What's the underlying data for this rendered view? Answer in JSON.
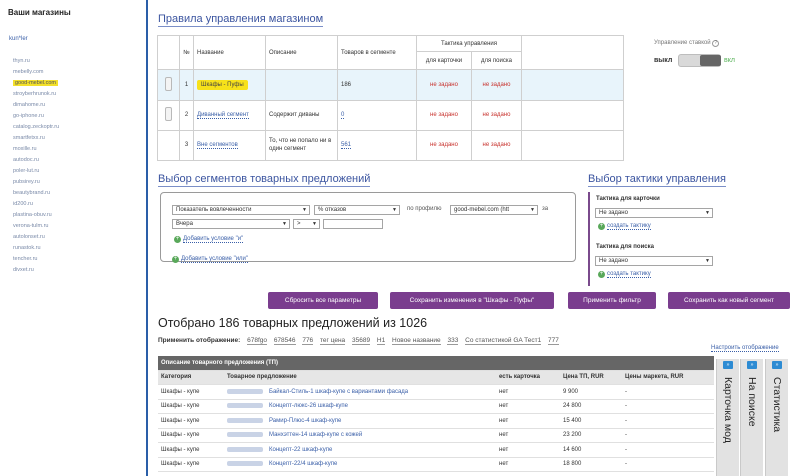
{
  "sidebar": {
    "title": "Ваши магазины",
    "user": "kun*ler",
    "shops": [
      "thyn.ru",
      "mebelly.com",
      "good-mebel.com",
      "stroyberhrunok.ru",
      "dimahome.ru",
      "go-iphone.ru",
      "catalog.zeckoptr.ru",
      "smartfetxx.ru",
      "moxille.ru",
      "autodoc.ru",
      "poler-lut.ru",
      "pubsirey.ru",
      "beautybrand.ru",
      "id200.ru",
      "plastina-obuv.ru",
      "verona-tulm.ru",
      "autolonset.ru",
      "runastok.ru",
      "tencher.ru",
      "divxet.ru"
    ],
    "active_shop": "good-mebel.com"
  },
  "rules": {
    "title": "Правила управления магазином",
    "headers": {
      "num": "№",
      "name": "Название",
      "desc": "Описание",
      "goods": "Товаров в сегменте",
      "tactic": "Тактика управления",
      "card": "для карточки",
      "search": "для поиска"
    },
    "rows": [
      {
        "num": "1",
        "name": "Шкафы - Пуфы",
        "desc": "",
        "count": "186",
        "card": "не задано",
        "search": "не задано"
      },
      {
        "num": "2",
        "name": "Диванный сегмент",
        "desc": "Содержит диваны",
        "count": "0",
        "card": "не задано",
        "search": "не задано"
      },
      {
        "num": "3",
        "name": "Вне сегментов",
        "desc": "То, что не попало ни в один сегмент",
        "count": "561",
        "card": "не задано",
        "search": "не задано"
      }
    ]
  },
  "bid_control": {
    "label": "Управление ставкой",
    "help": "?",
    "off": "выкл",
    "on": "вкл",
    "state": "off"
  },
  "segment_select": {
    "title": "Выбор сегментов товарных предложений",
    "metric": "Показатель вовлеченности",
    "measure": "% отказов",
    "by_profile": "по профилю",
    "profile": "good-mebel.com (htt",
    "for": "за",
    "period": "Вчера",
    "operator": ">",
    "value": "",
    "add_and": "Добавить условие \"и\"",
    "add_or": "Добавить условие \"или\""
  },
  "tactic_select": {
    "title": "Выбор тактики управления",
    "card_label": "Тактика для карточки",
    "card_value": "Не задано",
    "card_create": "создать тактику",
    "search_label": "Тактика для поиска",
    "search_value": "Не задано",
    "search_create": "создать тактику"
  },
  "buttons": {
    "reset": "Сбросить все параметры",
    "save_changes": "Сохранить изменения в \"Шкафы - Пуфы\"",
    "apply_filter": "Применить фильтр",
    "save_new": "Сохранить как новый сегмент"
  },
  "results": {
    "found_text": "Отобрано 186 товарных предложений из 1026",
    "apply_label": "Применить отображение:",
    "display_chips": [
      "678fgo",
      "678546",
      "776",
      "тег цена",
      "35689",
      "H1",
      "Новое название",
      "333",
      "Со статистикой GA Тест1",
      "777"
    ],
    "setup_link": "Настроить отображение",
    "band_title": "Описание товарного предложения (ТП)",
    "columns": [
      "Категория",
      "Товарное предложение",
      "есть карточка",
      "Цена ТП, RUR",
      "Цены маркета, RUR"
    ],
    "rows": [
      {
        "category": "Шкафы - купе",
        "offer": "Байкал-Стиль-1 шкаф-купе с вариантами фасада",
        "card": "нет",
        "price": "9 900",
        "market": "-"
      },
      {
        "category": "Шкафы - купе",
        "offer": "Концепт-люкс-26 шкаф-купе",
        "card": "нет",
        "price": "24 800",
        "market": "-"
      },
      {
        "category": "Шкафы - купе",
        "offer": "Рамир-Плюс-4 шкаф-купе",
        "card": "нет",
        "price": "15 400",
        "market": "-"
      },
      {
        "category": "Шкафы - купе",
        "offer": "Манхэттен-14 шкаф-купе с кожей",
        "card": "нет",
        "price": "23 200",
        "market": "-"
      },
      {
        "category": "Шкафы - купе",
        "offer": "Концепт-22 шкаф-купе",
        "card": "нет",
        "price": "14 600",
        "market": "-"
      },
      {
        "category": "Шкафы - купе",
        "offer": "Концепт-22/4 шкаф-купе",
        "card": "нет",
        "price": "18 800",
        "market": "-"
      }
    ],
    "side_panels": [
      "Карточка мод",
      "На поиске",
      "Статистика"
    ],
    "panel_arrow": "»"
  }
}
